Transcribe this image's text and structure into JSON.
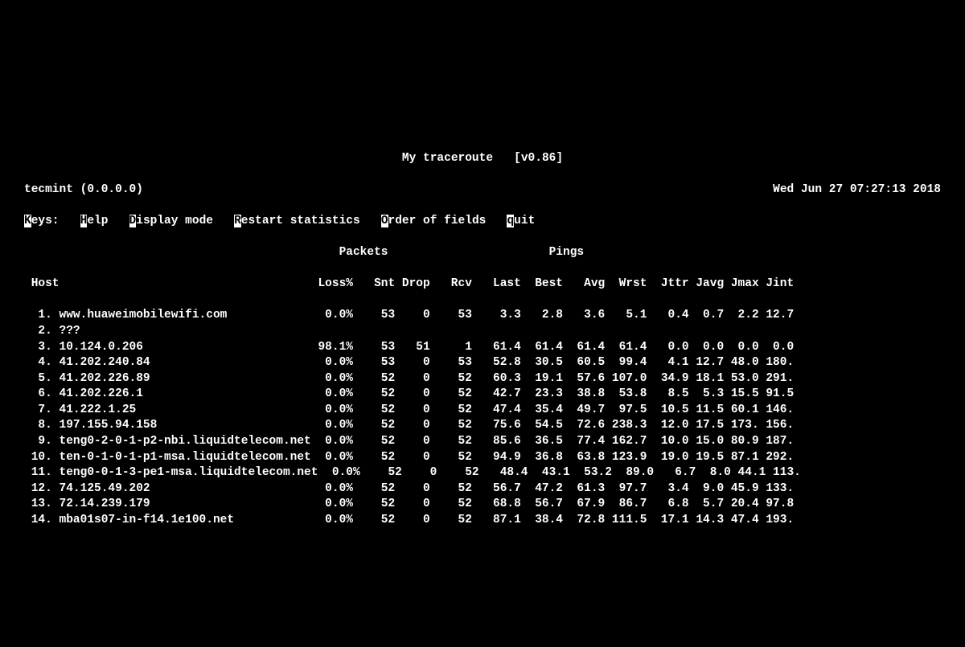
{
  "title": {
    "app": "My traceroute",
    "version": "[v0.86]"
  },
  "info": {
    "host_local": "tecmint (0.0.0.0)",
    "datetime": "Wed Jun 27 07:27:13 2018"
  },
  "keys": {
    "label": "eys:",
    "K": "K",
    "help_h": "H",
    "help_rest": "elp",
    "disp_d": "D",
    "disp_rest": "isplay mode",
    "rest_r": "R",
    "rest_rest": "estart statistics",
    "ord_o": "O",
    "ord_rest": "rder of fields",
    "quit_q": "q",
    "quit_rest": "uit"
  },
  "sections": {
    "packets": "Packets",
    "pings": "Pings"
  },
  "columns": {
    "host": "Host",
    "loss": "Loss%",
    "snt": "Snt",
    "drop": "Drop",
    "rcv": "Rcv",
    "last": "Last",
    "best": "Best",
    "avg": "Avg",
    "wrst": "Wrst",
    "jttr": "Jttr",
    "javg": "Javg",
    "jmax": "Jmax",
    "jint": "Jint"
  },
  "rows": [
    {
      "n": " 1.",
      "host": "www.huaweimobilewifi.com",
      "loss": "0.0%",
      "snt": "53",
      "drop": "0",
      "rcv": "53",
      "last": "3.3",
      "best": "2.8",
      "avg": "3.6",
      "wrst": "5.1",
      "jttr": "0.4",
      "javg": "0.7",
      "jmax": "2.2",
      "jint": "12.7",
      "bold": false
    },
    {
      "n": " 2.",
      "host": "???",
      "loss": "",
      "snt": "",
      "drop": "",
      "rcv": "",
      "last": "",
      "best": "",
      "avg": "",
      "wrst": "",
      "jttr": "",
      "javg": "",
      "jmax": "",
      "jint": "",
      "bold": false
    },
    {
      "n": " 3.",
      "host": "10.124.0.206",
      "loss": "98.1%",
      "snt": "53",
      "drop": "51",
      "rcv": "1",
      "last": "61.4",
      "best": "61.4",
      "avg": "61.4",
      "wrst": "61.4",
      "jttr": "0.0",
      "javg": "0.0",
      "jmax": "0.0",
      "jint": "0.0",
      "bold": true
    },
    {
      "n": " 4.",
      "host": "41.202.240.84",
      "loss": "0.0%",
      "snt": "53",
      "drop": "0",
      "rcv": "53",
      "last": "52.8",
      "best": "30.5",
      "avg": "60.5",
      "wrst": "99.4",
      "jttr": "4.1",
      "javg": "12.7",
      "jmax": "48.0",
      "jint": "180.",
      "bold": false
    },
    {
      "n": " 5.",
      "host": "41.202.226.89",
      "loss": "0.0%",
      "snt": "52",
      "drop": "0",
      "rcv": "52",
      "last": "60.3",
      "best": "19.1",
      "avg": "57.6",
      "wrst": "107.0",
      "jttr": "34.9",
      "javg": "18.1",
      "jmax": "53.0",
      "jint": "291.",
      "bold": false
    },
    {
      "n": " 6.",
      "host": "41.202.226.1",
      "loss": "0.0%",
      "snt": "52",
      "drop": "0",
      "rcv": "52",
      "last": "42.7",
      "best": "23.3",
      "avg": "38.8",
      "wrst": "53.8",
      "jttr": "8.5",
      "javg": "5.3",
      "jmax": "15.5",
      "jint": "91.5",
      "bold": false
    },
    {
      "n": " 7.",
      "host": "41.222.1.25",
      "loss": "0.0%",
      "snt": "52",
      "drop": "0",
      "rcv": "52",
      "last": "47.4",
      "best": "35.4",
      "avg": "49.7",
      "wrst": "97.5",
      "jttr": "10.5",
      "javg": "11.5",
      "jmax": "60.1",
      "jint": "146.",
      "bold": false
    },
    {
      "n": " 8.",
      "host": "197.155.94.158",
      "loss": "0.0%",
      "snt": "52",
      "drop": "0",
      "rcv": "52",
      "last": "75.6",
      "best": "54.5",
      "avg": "72.6",
      "wrst": "238.3",
      "jttr": "12.0",
      "javg": "17.5",
      "jmax": "173.",
      "jint": "156.",
      "bold": false
    },
    {
      "n": " 9.",
      "host": "teng0-2-0-1-p2-nbi.liquidtelecom.net",
      "loss": "0.0%",
      "snt": "52",
      "drop": "0",
      "rcv": "52",
      "last": "85.6",
      "best": "36.5",
      "avg": "77.4",
      "wrst": "162.7",
      "jttr": "10.0",
      "javg": "15.0",
      "jmax": "80.9",
      "jint": "187.",
      "bold": false
    },
    {
      "n": "10.",
      "host": "ten-0-1-0-1-p1-msa.liquidtelecom.net",
      "loss": "0.0%",
      "snt": "52",
      "drop": "0",
      "rcv": "52",
      "last": "94.9",
      "best": "36.8",
      "avg": "63.8",
      "wrst": "123.9",
      "jttr": "19.0",
      "javg": "19.5",
      "jmax": "87.1",
      "jint": "292.",
      "bold": false
    },
    {
      "n": "11.",
      "host": "teng0-0-1-3-pe1-msa.liquidtelecom.net",
      "loss": "0.0%",
      "snt": "52",
      "drop": "0",
      "rcv": "52",
      "last": "48.4",
      "best": "43.1",
      "avg": "53.2",
      "wrst": "89.0",
      "jttr": "6.7",
      "javg": "8.0",
      "jmax": "44.1",
      "jint": "113.",
      "bold": false
    },
    {
      "n": "12.",
      "host": "74.125.49.202",
      "loss": "0.0%",
      "snt": "52",
      "drop": "0",
      "rcv": "52",
      "last": "56.7",
      "best": "47.2",
      "avg": "61.3",
      "wrst": "97.7",
      "jttr": "3.4",
      "javg": "9.0",
      "jmax": "45.9",
      "jint": "133.",
      "bold": false
    },
    {
      "n": "13.",
      "host": "72.14.239.179",
      "loss": "0.0%",
      "snt": "52",
      "drop": "0",
      "rcv": "52",
      "last": "68.8",
      "best": "56.7",
      "avg": "67.9",
      "wrst": "86.7",
      "jttr": "6.8",
      "javg": "5.7",
      "jmax": "20.4",
      "jint": "97.8",
      "bold": false
    },
    {
      "n": "14.",
      "host": "mba01s07-in-f14.1e100.net",
      "loss": "0.0%",
      "snt": "52",
      "drop": "0",
      "rcv": "52",
      "last": "87.1",
      "best": "38.4",
      "avg": "72.8",
      "wrst": "111.5",
      "jttr": "17.1",
      "javg": "14.3",
      "jmax": "47.4",
      "jint": "193.",
      "bold": false
    }
  ]
}
